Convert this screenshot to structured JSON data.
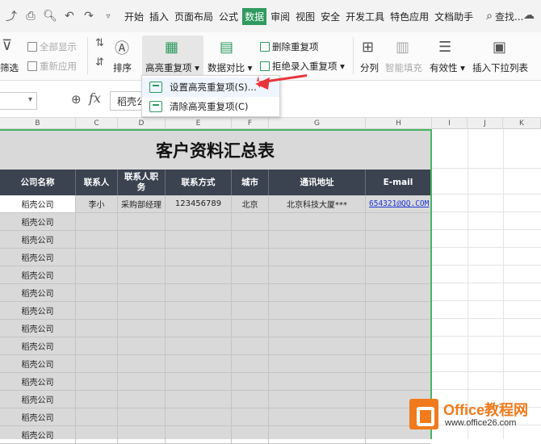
{
  "menubar": {
    "tabs": [
      "开始",
      "插入",
      "页面布局",
      "公式",
      "数据",
      "审阅",
      "视图",
      "安全",
      "开发工具",
      "特色应用",
      "文档助手"
    ],
    "active_tab": "数据",
    "search_label": "查找..."
  },
  "ribbon": {
    "filter": "筛选",
    "show_all": "全部显示",
    "reapply": "重新应用",
    "sort": "排序",
    "highlight_dup": "高亮重复项",
    "data_compare": "数据对比",
    "delete_dup": "删除重复项",
    "reject_dup": "拒绝录入重复项",
    "split": "分列",
    "smart_fill": "智能填充",
    "validity": "有效性",
    "insert_dropdown": "插入下拉列表"
  },
  "formula": {
    "value": "稻壳公司"
  },
  "columns": [
    "B",
    "C",
    "D",
    "E",
    "F",
    "G",
    "H",
    "I",
    "J",
    "K"
  ],
  "dropdown": {
    "items": [
      "设置高亮重复项(S)...",
      "清除高亮重复项(C)"
    ]
  },
  "table": {
    "title": "客户资料汇总表",
    "headers": [
      "公司名称",
      "联系人",
      "联系人职务",
      "联系方式",
      "城市",
      "通讯地址",
      "E-mail"
    ],
    "first_row": [
      "稻壳公司",
      "李小",
      "采购部经理",
      "123456789",
      "北京",
      "北京科技大厦***",
      "654321@QQ.COM"
    ],
    "company_col": [
      "稻壳公司",
      "稻壳公司",
      "稻壳公司",
      "稻壳公司",
      "稻壳公司",
      "稻壳公司",
      "稻壳公司",
      "稻壳公司",
      "稻壳公司",
      "稻壳公司",
      "稻壳公司",
      "稻壳公司",
      "稻壳公司"
    ]
  },
  "watermark": {
    "brand": "Office教程网",
    "url": "www.office26.com"
  },
  "colors": {
    "accent": "#2e9a5f",
    "header_bg": "#3b4250",
    "table_bg": "#d9d9d9",
    "selection_border": "#48b463",
    "arrow": "#e8343a",
    "watermark": "#f07a1c"
  }
}
